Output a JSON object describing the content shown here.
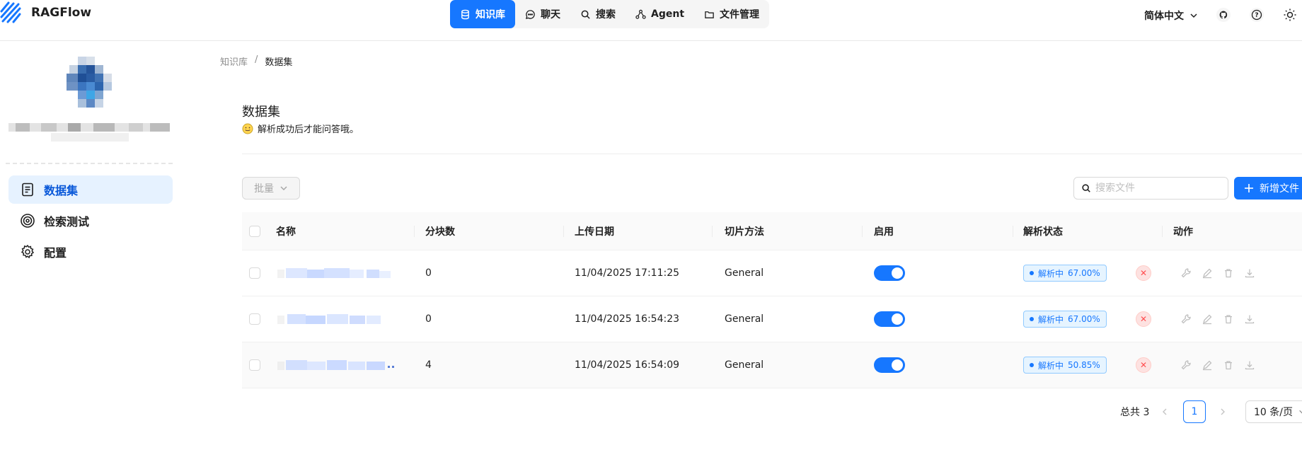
{
  "app": {
    "name": "RAGFlow"
  },
  "nav": {
    "items": [
      {
        "label": "知识库",
        "icon": "database-icon",
        "active": true
      },
      {
        "label": "聊天",
        "icon": "chat-icon",
        "active": false
      },
      {
        "label": "搜索",
        "icon": "search-icon",
        "active": false
      },
      {
        "label": "Agent",
        "icon": "agent-icon",
        "active": false
      },
      {
        "label": "文件管理",
        "icon": "folder-icon",
        "active": false
      }
    ]
  },
  "header": {
    "language": "简体中文"
  },
  "sidebar": {
    "items": [
      {
        "label": "数据集",
        "icon": "document-icon",
        "active": true
      },
      {
        "label": "检索测试",
        "icon": "target-icon",
        "active": false
      },
      {
        "label": "配置",
        "icon": "gear-icon",
        "active": false
      }
    ]
  },
  "breadcrumb": {
    "root": "知识库",
    "separator": "/",
    "current": "数据集"
  },
  "page": {
    "title": "数据集",
    "tip": "解析成功后才能问答哦。"
  },
  "toolbar": {
    "bulk_label": "批量",
    "search_placeholder": "搜索文件",
    "add_label": "新增文件"
  },
  "table": {
    "columns": [
      "名称",
      "分块数",
      "上传日期",
      "切片方法",
      "启用",
      "解析状态",
      "动作"
    ],
    "rows": [
      {
        "chunks": "0",
        "date": "11/04/2025 17:11:25",
        "method": "General",
        "enabled": true,
        "status": "解析中",
        "progress": "67.00%"
      },
      {
        "chunks": "0",
        "date": "11/04/2025 16:54:23",
        "method": "General",
        "enabled": true,
        "status": "解析中",
        "progress": "67.00%"
      },
      {
        "chunks": "4",
        "date": "11/04/2025 16:54:09",
        "method": "General",
        "enabled": true,
        "status": "解析中",
        "progress": "50.85%"
      }
    ]
  },
  "pagination": {
    "total_label": "总共 3",
    "current_page": "1",
    "page_size": "10 条/页"
  },
  "colors": {
    "primary": "#1677ff",
    "danger": "#ff4d4f"
  }
}
